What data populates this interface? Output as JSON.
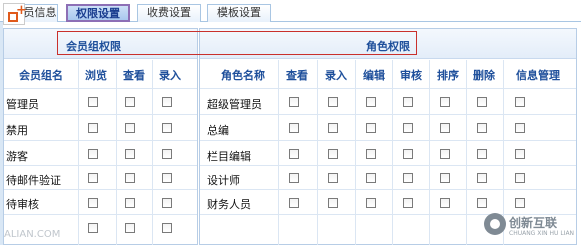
{
  "tabs": [
    "员信息",
    "权限设置",
    "收费设置",
    "模板设置"
  ],
  "group_panel": {
    "title": "会员组权限",
    "columns": [
      "会员组名",
      "浏览",
      "查看",
      "录入"
    ],
    "rows": [
      "管理员",
      "禁用",
      "游客",
      "待邮件验证",
      "待审核"
    ]
  },
  "role_panel": {
    "title": "角色权限",
    "columns": [
      "角色名称",
      "查看",
      "录入",
      "编辑",
      "审核",
      "排序",
      "删除",
      "信息管理"
    ],
    "rows": [
      "超级管理员",
      "总编",
      "栏目编辑",
      "设计师",
      "财务人员"
    ]
  },
  "watermark": {
    "left_text": "ALIAN.COM",
    "brand": "创新互联",
    "brand_sub": "CHUANG XIN HU LIAN"
  },
  "colors": {
    "accent": "#1e4f9b",
    "highlight": "#c9302c",
    "active_tab_border": "#8d6fb5"
  }
}
